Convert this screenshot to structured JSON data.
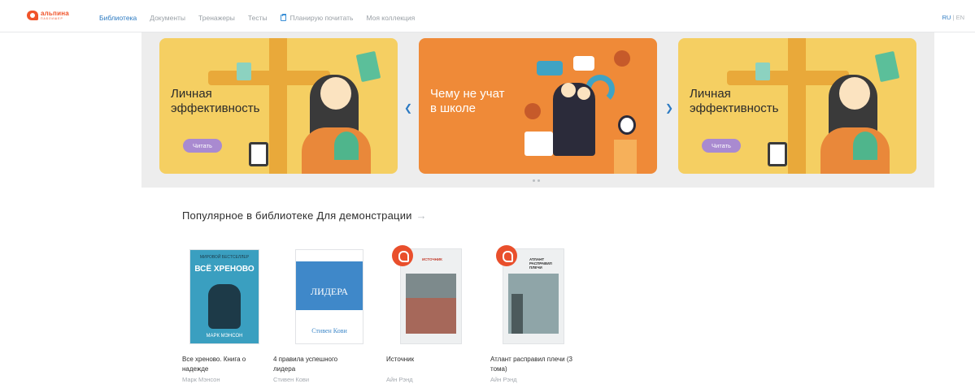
{
  "logo": {
    "line1": "альпина",
    "line2": "ПАБЛИШЕР"
  },
  "nav": {
    "items": [
      {
        "label": "Библиотека",
        "active": true
      },
      {
        "label": "Документы",
        "active": false
      },
      {
        "label": "Тренажеры",
        "active": false
      },
      {
        "label": "Тесты",
        "active": false
      },
      {
        "label": "Планирую почитать",
        "active": false,
        "icon": "clipboard-icon"
      },
      {
        "label": "Моя коллекция",
        "active": false
      }
    ],
    "lang": {
      "ru": "RU",
      "sep": " | ",
      "en": "EN"
    }
  },
  "carousel": {
    "slides": [
      {
        "title": "Личная\nэффективность",
        "button": "Читать",
        "color": "#f5cf62"
      },
      {
        "title": "Чему не учат\nв школе",
        "button": "",
        "color": "#ef8a38"
      },
      {
        "title": "Личная\nэффективность",
        "button": "Читать",
        "color": "#f5cf62"
      }
    ],
    "prev_icon": "chevron-left-icon",
    "next_icon": "chevron-right-icon",
    "dots": 2
  },
  "section": {
    "title": "Популярное в библиотеке Для демонстрации",
    "arrow": "→"
  },
  "books": [
    {
      "title": "Все хреново. Книга о надежде",
      "author": "Марк Мэнсон",
      "cover_color": "#3a9fc0",
      "cover_text_top": "ВСЁ ХРЕНОВО",
      "cover_text_bottom": "МАРК МЭНСОН"
    },
    {
      "title": "4 правила успешного лидера",
      "author": "Стивен Кови",
      "cover_color": "#3f88c9",
      "cover_text_top": "ЛИДЕРА",
      "cover_text_bottom": "Стивен Кови"
    },
    {
      "title": "Источник",
      "author": "Айн Рэнд",
      "cover_color": "#7d8a8c",
      "cover_text_top": "ИСТОЧНИК",
      "cover_text_bottom": ""
    },
    {
      "title": "Атлант расправил плечи (3 тома)",
      "author": "Айн Рэнд",
      "cover_color": "#8fa5a8",
      "cover_text_top": "АТЛАНТ РАСПРАВИЛ ПЛЕЧИ",
      "cover_text_bottom": ""
    }
  ]
}
